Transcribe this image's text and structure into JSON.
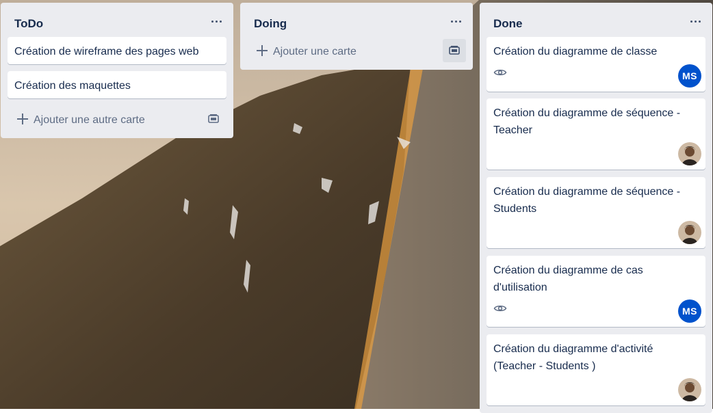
{
  "board": {
    "colors": {
      "list_bg": "#ebecf0",
      "card_bg": "#ffffff",
      "text": "#172b4d",
      "muted": "#5e6c84",
      "avatar_ms": "#0052cc"
    }
  },
  "lists": [
    {
      "title": "ToDo",
      "menu_icon": "more-horizontal-icon",
      "cards": [
        {
          "text": "Création de wireframe des pages web"
        },
        {
          "text": "Création des maquettes"
        }
      ],
      "add_label": "Ajouter une autre carte",
      "template_icon": "card-template-icon"
    },
    {
      "title": "Doing",
      "menu_icon": "more-horizontal-icon",
      "cards": [],
      "add_label": "Ajouter une carte",
      "template_icon": "card-template-icon"
    },
    {
      "title": "Done",
      "menu_icon": "more-horizontal-icon",
      "cards": [
        {
          "text": "Création du diagramme de classe",
          "badge_icon": "eye-icon",
          "member": "MS"
        },
        {
          "text": "Création du diagramme de séquence - Teacher",
          "member": "photo-avatar"
        },
        {
          "text": "Création du diagramme de séquence - Students",
          "member": "photo-avatar"
        },
        {
          "text": "Création du diagramme de cas d'utilisation",
          "badge_icon": "eye-icon",
          "member": "MS"
        },
        {
          "text": "Création du diagramme d'activité (Teacher - Students )",
          "member": "photo-avatar"
        }
      ]
    }
  ]
}
